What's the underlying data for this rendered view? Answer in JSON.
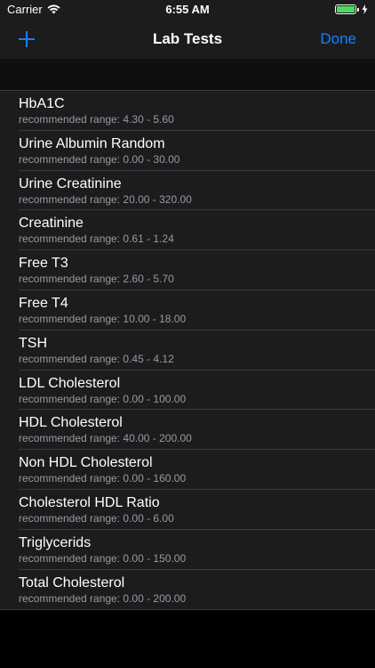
{
  "status": {
    "carrier": "Carrier",
    "time": "6:55 AM"
  },
  "nav": {
    "title": "Lab Tests",
    "done_label": "Done",
    "add_icon": "plus-icon",
    "accent": "#1a7fff"
  },
  "tests": [
    {
      "name": "HbA1C",
      "range": "recommended range: 4.30 - 5.60"
    },
    {
      "name": "Urine Albumin Random",
      "range": "recommended range: 0.00 - 30.00"
    },
    {
      "name": "Urine Creatinine",
      "range": "recommended range: 20.00 - 320.00"
    },
    {
      "name": "Creatinine",
      "range": "recommended range: 0.61 - 1.24"
    },
    {
      "name": "Free T3",
      "range": "recommended range: 2.60 - 5.70"
    },
    {
      "name": "Free T4",
      "range": "recommended range: 10.00 - 18.00"
    },
    {
      "name": "TSH",
      "range": "recommended range: 0.45 - 4.12"
    },
    {
      "name": "LDL Cholesterol",
      "range": "recommended range: 0.00 - 100.00"
    },
    {
      "name": "HDL Cholesterol",
      "range": "recommended range: 40.00 - 200.00"
    },
    {
      "name": "Non HDL Cholesterol",
      "range": "recommended range: 0.00 - 160.00"
    },
    {
      "name": "Cholesterol HDL Ratio",
      "range": "recommended range: 0.00 - 6.00"
    },
    {
      "name": "Triglycerids",
      "range": "recommended range: 0.00 - 150.00"
    },
    {
      "name": "Total Cholesterol",
      "range": "recommended range: 0.00 - 200.00"
    }
  ]
}
